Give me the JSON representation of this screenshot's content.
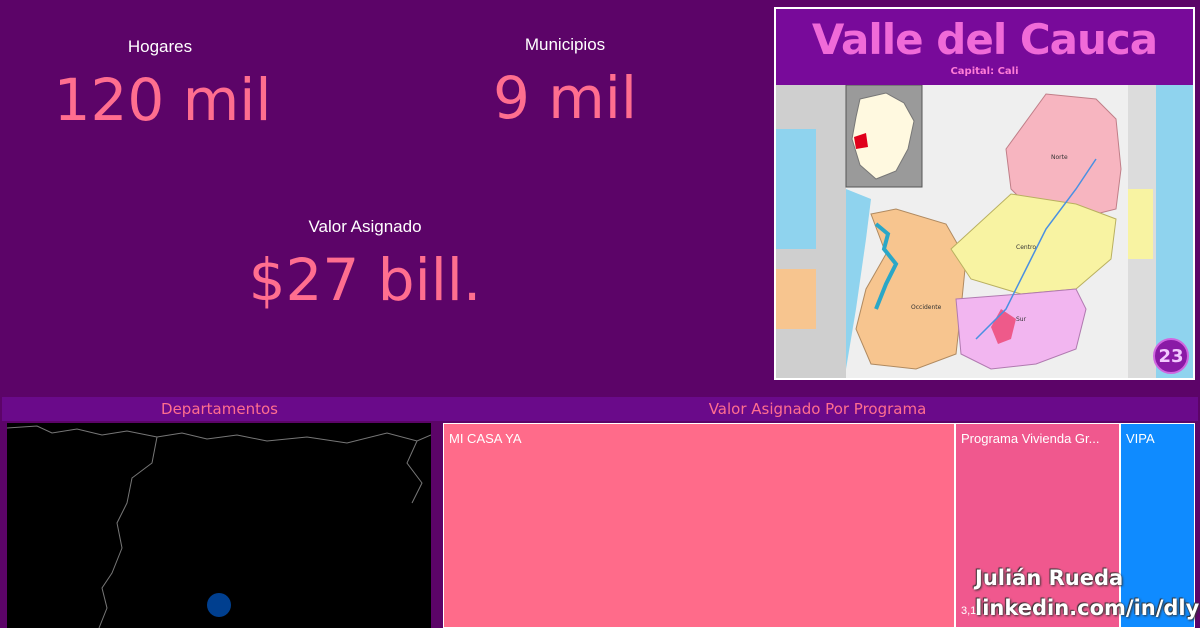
{
  "kpis": {
    "hogares": {
      "label": "Hogares",
      "value": "120 mil"
    },
    "municipios": {
      "label": "Municipios",
      "value": "9 mil"
    },
    "valor_asignado": {
      "label": "Valor Asignado",
      "value": "$27 bill."
    }
  },
  "region_map": {
    "title": "Valle del Cauca",
    "subtitle": "Capital: Cali",
    "badge": "23",
    "zones": [
      "Norte",
      "Centro",
      "Occidente",
      "Sur"
    ]
  },
  "departamentos": {
    "title": "Departamentos"
  },
  "treemap": {
    "title": "Valor Asignado Por Programa",
    "tiles": [
      {
        "label": "MI CASA YA",
        "color": "#ff6b8a"
      },
      {
        "label": "Programa Vivienda Gr...",
        "value": "3,1",
        "color": "#f0588e"
      },
      {
        "label": "VIPA",
        "color": "#0f8bff"
      }
    ]
  },
  "watermark": {
    "name": "Julián Rueda",
    "link": "linkedin.com/in/dlyst"
  }
}
